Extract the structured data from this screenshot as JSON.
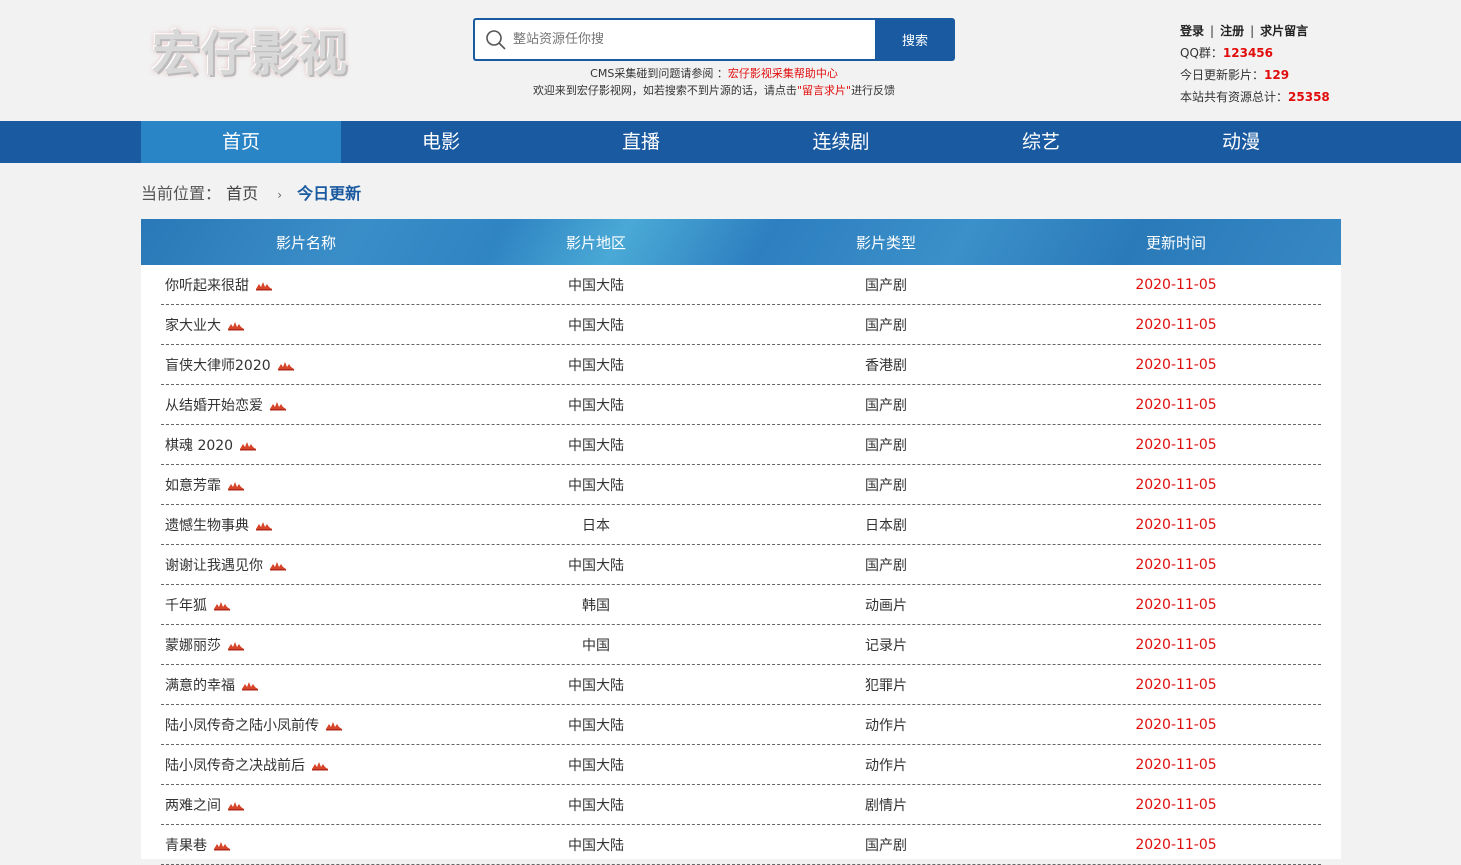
{
  "logo": {
    "text": "宏仔影视"
  },
  "search": {
    "placeholder": "整站资源任你搜",
    "button": "搜索"
  },
  "notice": {
    "line1_prefix": "CMS采集碰到问题请参阅 ：",
    "line1_link": "宏仔影视采集帮助中心",
    "line2_prefix": "欢迎来到宏仔影视网，如若搜索不到片源的话，请点击",
    "line2_link": "\"留言求片\"",
    "line2_suffix": "进行反馈"
  },
  "user": {
    "login": "登录",
    "register": "注册",
    "request": "求片留言",
    "qq_label": "QQ群：",
    "qq_value": "123456",
    "today_label": "今日更新影片：",
    "today_value": "129",
    "total_label": "本站共有资源总计：",
    "total_value": "25358"
  },
  "nav": [
    "首页",
    "电影",
    "直播",
    "连续剧",
    "综艺",
    "动漫"
  ],
  "breadcrumb": {
    "label": "当前位置：",
    "home": "首页",
    "arrow": "›",
    "current": "今日更新"
  },
  "table": {
    "headers": [
      "影片名称",
      "影片地区",
      "影片类型",
      "更新时间"
    ],
    "rows": [
      [
        "你听起来很甜",
        "中国大陆",
        "国产剧",
        "2020-11-05"
      ],
      [
        "家大业大",
        "中国大陆",
        "国产剧",
        "2020-11-05"
      ],
      [
        "盲侠大律师2020",
        "中国大陆",
        "香港剧",
        "2020-11-05"
      ],
      [
        "从结婚开始恋爱",
        "中国大陆",
        "国产剧",
        "2020-11-05"
      ],
      [
        "棋魂 2020",
        "中国大陆",
        "国产剧",
        "2020-11-05"
      ],
      [
        "如意芳霏",
        "中国大陆",
        "国产剧",
        "2020-11-05"
      ],
      [
        "遗憾生物事典",
        "日本",
        "日本剧",
        "2020-11-05"
      ],
      [
        "谢谢让我遇见你",
        "中国大陆",
        "国产剧",
        "2020-11-05"
      ],
      [
        "千年狐",
        "韩国",
        "动画片",
        "2020-11-05"
      ],
      [
        "蒙娜丽莎",
        "中国",
        "记录片",
        "2020-11-05"
      ],
      [
        "满意的幸福",
        "中国大陆",
        "犯罪片",
        "2020-11-05"
      ],
      [
        "陆小凤传奇之陆小凤前传",
        "中国大陆",
        "动作片",
        "2020-11-05"
      ],
      [
        "陆小凤传奇之决战前后",
        "中国大陆",
        "动作片",
        "2020-11-05"
      ],
      [
        "两难之间",
        "中国大陆",
        "剧情片",
        "2020-11-05"
      ],
      [
        "青果巷",
        "中国大陆",
        "国产剧",
        "2020-11-05"
      ]
    ]
  },
  "colors": {
    "primary": "#1a5aa0",
    "active_nav": "#2a85c7",
    "date_red": "#e10d0d"
  }
}
